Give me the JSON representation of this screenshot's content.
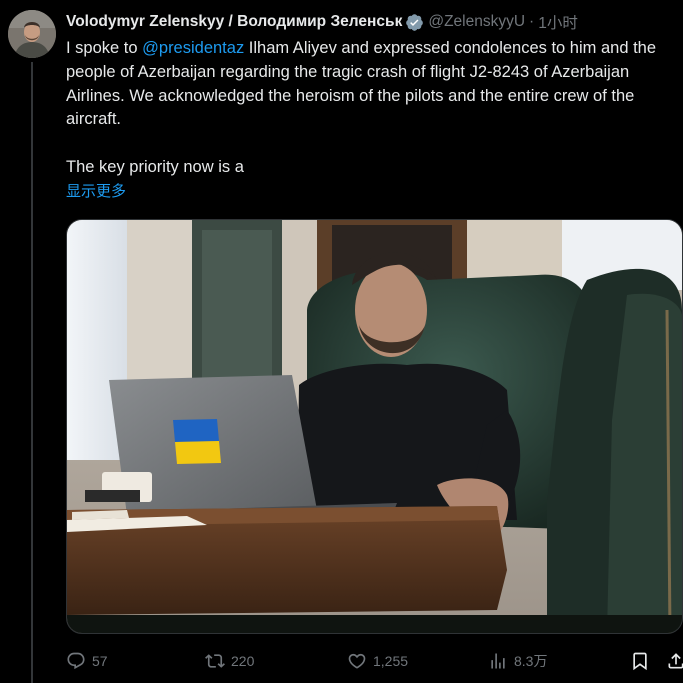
{
  "tweet": {
    "author": {
      "display_name": "Volodymyr Zelenskyy / Володимир Зеленськ",
      "handle": "@ZelenskyyU",
      "separator": "·",
      "timestamp": "1小时"
    },
    "text": {
      "before_mention": "I spoke to ",
      "mention": "@presidentaz",
      "after_mention": " Ilham Aliyev and expressed condolences to him and the people of Azerbaijan regarding the tragic crash of flight J2-8243 of Azerbaijan Airlines. We acknowledged the heroism of the pilots and the entire crew of the aircraft.",
      "paragraph2": "The key priority now is a",
      "show_more": "显示更多"
    },
    "actions": {
      "replies": "57",
      "reposts": "220",
      "likes": "1,255",
      "views": "8.3万"
    },
    "colors": {
      "link": "#1d9bf0",
      "muted": "#71767b",
      "text": "#e7e9ea",
      "background": "#000000"
    }
  }
}
